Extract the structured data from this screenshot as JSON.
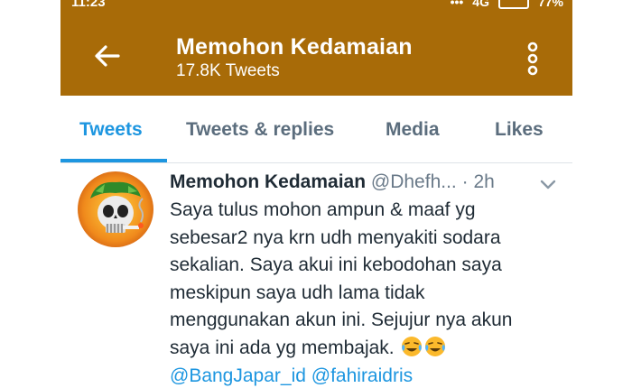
{
  "status_bar": {
    "time": "11:23",
    "network": "4G",
    "battery": "77%"
  },
  "header": {
    "title": "Memohon Kedamaian",
    "subtitle": "17.8K Tweets"
  },
  "tabs": [
    {
      "label": "Tweets",
      "active": true
    },
    {
      "label": "Tweets & replies",
      "active": false
    },
    {
      "label": "Media",
      "active": false
    },
    {
      "label": "Likes",
      "active": false
    }
  ],
  "tweet": {
    "name": "Memohon Kedamaian",
    "handle": "@Dhefh...",
    "separator": "·",
    "time": "2h",
    "lines": [
      "Saya tulus mohon ampun & maaf yg",
      "sebesar2 nya krn udh menyakiti sodara",
      "sekalian. Saya akui ini kebodohan saya",
      "meskipun saya udh lama tidak",
      "menggunakan akun ini. Sejujur nya akun",
      "saya ini ada yg membajak."
    ],
    "mentions": [
      "@BangJapar_id",
      "@fahiraidris"
    ],
    "emoji": [
      "crying-laughing-emoji",
      "crying-laughing-emoji"
    ]
  },
  "colors": {
    "header_bg": "#a86b08",
    "accent": "#1d96e0",
    "text": "#1f2b35",
    "muted": "#6a7a89"
  }
}
